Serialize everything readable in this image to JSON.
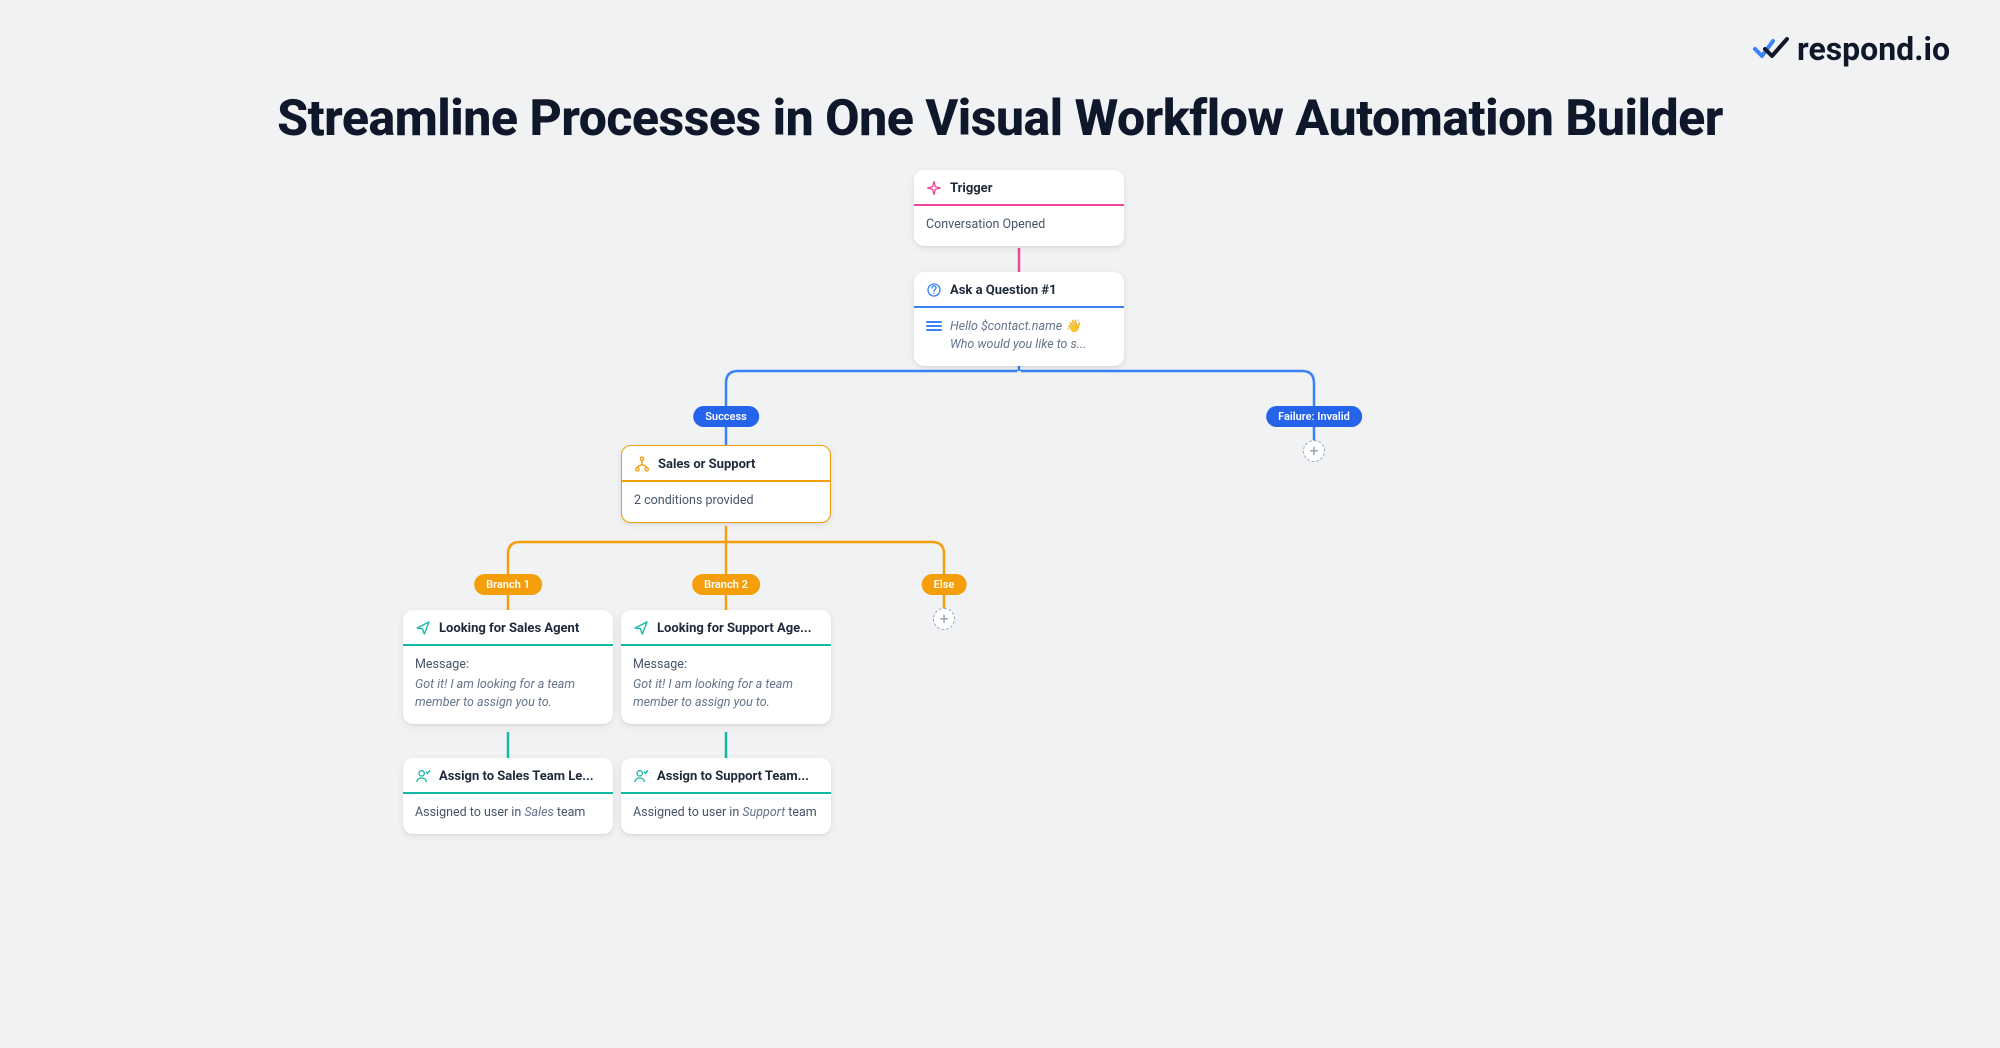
{
  "brand": {
    "name": "respond.io"
  },
  "title": "Streamline Processes in One Visual Workflow Automation Builder",
  "nodes": {
    "trigger": {
      "title": "Trigger",
      "body": "Conversation Opened"
    },
    "question": {
      "title": "Ask a Question #1",
      "line1": "Hello $contact.name 👋",
      "line2": "Who would you like to s..."
    },
    "branch_pill_success": "Success",
    "branch_pill_failure": "Failure: Invalid",
    "condition": {
      "title": "Sales or Support",
      "body": "2 conditions provided"
    },
    "branch1_pill": "Branch 1",
    "branch2_pill": "Branch 2",
    "else_pill": "Else",
    "sales_agent": {
      "title": "Looking for Sales Agent",
      "label": "Message:",
      "msg": "Got it! I am looking for a team member to assign you to."
    },
    "support_agent": {
      "title": "Looking for Support Age...",
      "label": "Message:",
      "msg": "Got it! I am looking for a team member to assign you to."
    },
    "assign_sales": {
      "title": "Assign to Sales Team Le...",
      "prefix": "Assigned to user in ",
      "team": "Sales",
      "suffix": " team"
    },
    "assign_support": {
      "title": "Assign to Support Team...",
      "prefix": "Assigned to user in ",
      "team": "Support",
      "suffix": " team"
    }
  }
}
